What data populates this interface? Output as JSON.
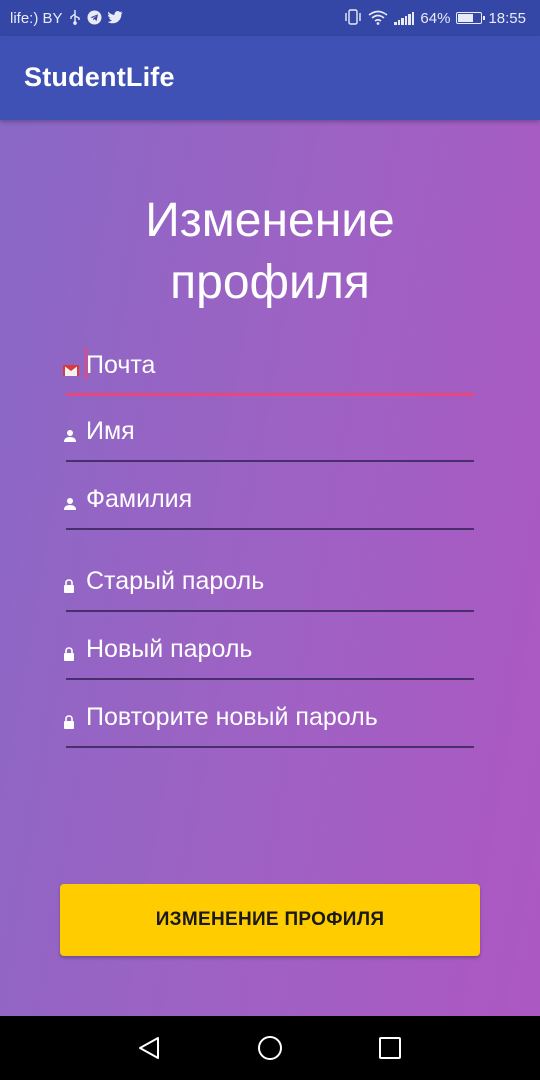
{
  "status_bar": {
    "carrier": "life:) BY",
    "battery_percent": "64%",
    "battery_level": 0.64,
    "time": "18:55",
    "icons": [
      "usb-icon",
      "telegram-icon",
      "twitter-icon",
      "vibrate-icon",
      "wifi-icon",
      "signal-icon",
      "battery-icon"
    ]
  },
  "app_bar": {
    "title": "StudentLife"
  },
  "page": {
    "title_line1": "Изменение",
    "title_line2": "профиля"
  },
  "form": {
    "email": {
      "placeholder": "Почта",
      "icon": "mail-icon"
    },
    "first_name": {
      "placeholder": "Имя",
      "icon": "person-icon"
    },
    "last_name": {
      "placeholder": "Фамилия",
      "icon": "person-icon"
    },
    "old_password": {
      "placeholder": "Старый пароль",
      "icon": "lock-icon"
    },
    "new_password": {
      "placeholder": "Новый пароль",
      "icon": "lock-icon"
    },
    "repeat_password": {
      "placeholder": "Повторите новый пароль",
      "icon": "lock-icon"
    },
    "submit_label": "ИЗМЕНЕНИЕ ПРОФИЛЯ"
  },
  "colors": {
    "status_bar": "#3547a6",
    "app_bar": "#3f51b5",
    "gradient_start": "#8a68c6",
    "gradient_end": "#ad58c2",
    "accent": "#e8467f",
    "button": "#ffcc00"
  },
  "nav_bar": {
    "icons": [
      "back-icon",
      "home-icon",
      "recents-icon"
    ]
  }
}
